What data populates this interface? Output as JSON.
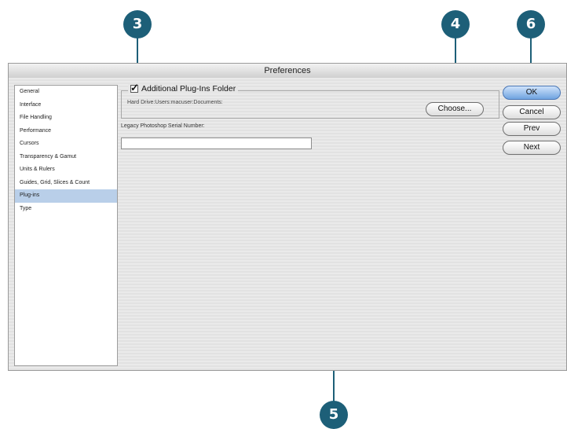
{
  "callouts": {
    "three": "3",
    "four": "4",
    "five": "5",
    "six": "6"
  },
  "window": {
    "title": "Preferences"
  },
  "sidebar": {
    "items": [
      {
        "label": "General"
      },
      {
        "label": "Interface"
      },
      {
        "label": "File Handling"
      },
      {
        "label": "Performance"
      },
      {
        "label": "Cursors"
      },
      {
        "label": "Transparency & Gamut"
      },
      {
        "label": "Units & Rulers"
      },
      {
        "label": "Guides, Grid, Slices & Count"
      },
      {
        "label": "Plug-ins"
      },
      {
        "label": "Type"
      }
    ],
    "selected": "Plug-ins"
  },
  "plugins": {
    "checkbox_label": "Additional Plug-Ins Folder",
    "checked": true,
    "path": "Hard Drive:Users:macuser:Documents:",
    "choose_label": "Choose...",
    "serial_label": "Legacy Photoshop Serial Number:",
    "serial_value": ""
  },
  "buttons": {
    "ok": "OK",
    "cancel": "Cancel",
    "prev": "Prev",
    "next": "Next"
  },
  "colors": {
    "callout": "#1d5f78",
    "selected": "#b9cfe9",
    "ok_button": "#6fa3e0"
  }
}
